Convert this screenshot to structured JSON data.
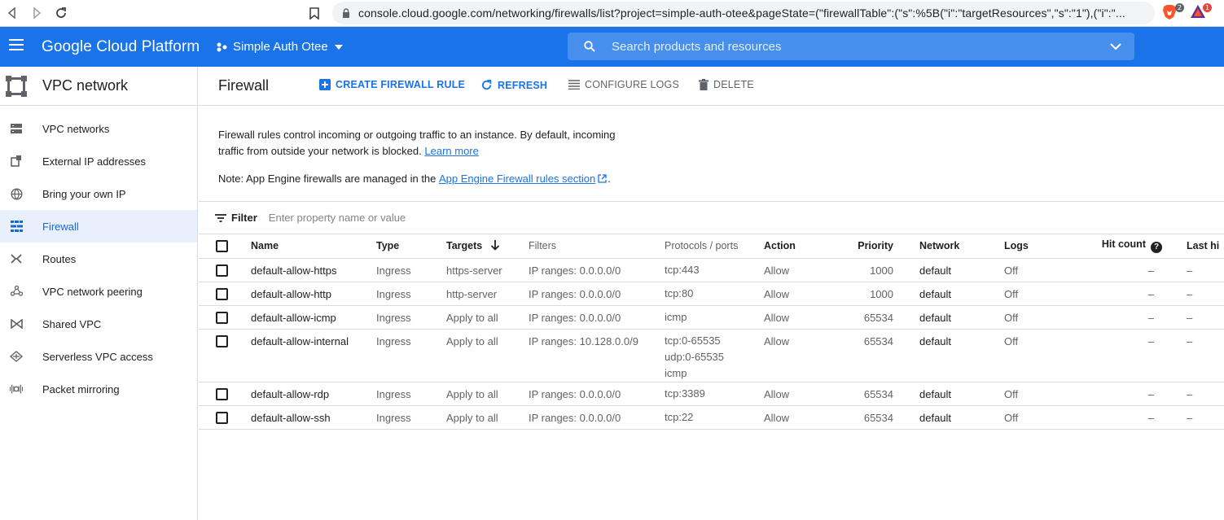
{
  "browser": {
    "url": "console.cloud.google.com/networking/firewalls/list?project=simple-auth-otee&pageState=(\"firewallTable\":(\"s\":%5B(\"i\":\"targetResources\",\"s\":\"1\"),(\"i\":\"...",
    "brave_badge": "2",
    "alert_badge": "1"
  },
  "header": {
    "brand": "Google Cloud Platform",
    "project": "Simple Auth Otee",
    "search_placeholder": "Search products and resources"
  },
  "sidebar": {
    "title": "VPC network",
    "items": [
      {
        "label": "VPC networks",
        "icon": "vpc-networks-icon"
      },
      {
        "label": "External IP addresses",
        "icon": "external-ip-icon"
      },
      {
        "label": "Bring your own IP",
        "icon": "globe-icon"
      },
      {
        "label": "Firewall",
        "icon": "firewall-icon",
        "active": true
      },
      {
        "label": "Routes",
        "icon": "routes-icon"
      },
      {
        "label": "VPC network peering",
        "icon": "peering-icon"
      },
      {
        "label": "Shared VPC",
        "icon": "shared-vpc-icon"
      },
      {
        "label": "Serverless VPC access",
        "icon": "serverless-icon"
      },
      {
        "label": "Packet mirroring",
        "icon": "packet-mirroring-icon"
      }
    ]
  },
  "toolbar": {
    "title": "Firewall",
    "create_label": "CREATE FIREWALL RULE",
    "refresh_label": "REFRESH",
    "configure_logs_label": "CONFIGURE LOGS",
    "delete_label": "DELETE"
  },
  "description": {
    "text": "Firewall rules control incoming or outgoing traffic to an instance. By default, incoming traffic from outside your network is blocked.",
    "learn_more": "Learn more",
    "note_prefix": "Note: App Engine firewalls are managed in the",
    "note_link": "App Engine Firewall rules section",
    "note_suffix": "."
  },
  "filter": {
    "label": "Filter",
    "placeholder": "Enter property name or value"
  },
  "table": {
    "columns": [
      "Name",
      "Type",
      "Targets",
      "Filters",
      "Protocols / ports",
      "Action",
      "Priority",
      "Network",
      "Logs",
      "Hit count",
      "Last hi"
    ],
    "rows": [
      {
        "name": "default-allow-https",
        "type": "Ingress",
        "targets": "https-server",
        "filters": "IP ranges: 0.0.0.0/0",
        "ports": [
          "tcp:443"
        ],
        "action": "Allow",
        "priority": "1000",
        "network": "default",
        "logs": "Off",
        "hit": "–",
        "last": "–"
      },
      {
        "name": "default-allow-http",
        "type": "Ingress",
        "targets": "http-server",
        "filters": "IP ranges: 0.0.0.0/0",
        "ports": [
          "tcp:80"
        ],
        "action": "Allow",
        "priority": "1000",
        "network": "default",
        "logs": "Off",
        "hit": "–",
        "last": "–"
      },
      {
        "name": "default-allow-icmp",
        "type": "Ingress",
        "targets": "Apply to all",
        "filters": "IP ranges: 0.0.0.0/0",
        "ports": [
          "icmp"
        ],
        "action": "Allow",
        "priority": "65534",
        "network": "default",
        "logs": "Off",
        "hit": "–",
        "last": "–"
      },
      {
        "name": "default-allow-internal",
        "type": "Ingress",
        "targets": "Apply to all",
        "filters": "IP ranges: 10.128.0.0/9",
        "ports": [
          "tcp:0-65535",
          "udp:0-65535",
          "icmp"
        ],
        "action": "Allow",
        "priority": "65534",
        "network": "default",
        "logs": "Off",
        "hit": "–",
        "last": "–"
      },
      {
        "name": "default-allow-rdp",
        "type": "Ingress",
        "targets": "Apply to all",
        "filters": "IP ranges: 0.0.0.0/0",
        "ports": [
          "tcp:3389"
        ],
        "action": "Allow",
        "priority": "65534",
        "network": "default",
        "logs": "Off",
        "hit": "–",
        "last": "–"
      },
      {
        "name": "default-allow-ssh",
        "type": "Ingress",
        "targets": "Apply to all",
        "filters": "IP ranges: 0.0.0.0/0",
        "ports": [
          "tcp:22"
        ],
        "action": "Allow",
        "priority": "65534",
        "network": "default",
        "logs": "Off",
        "hit": "–",
        "last": "–"
      }
    ]
  },
  "colors": {
    "brand_blue": "#1a73e8",
    "active_bg": "#e8f0fe",
    "active_text": "#1967d2"
  }
}
